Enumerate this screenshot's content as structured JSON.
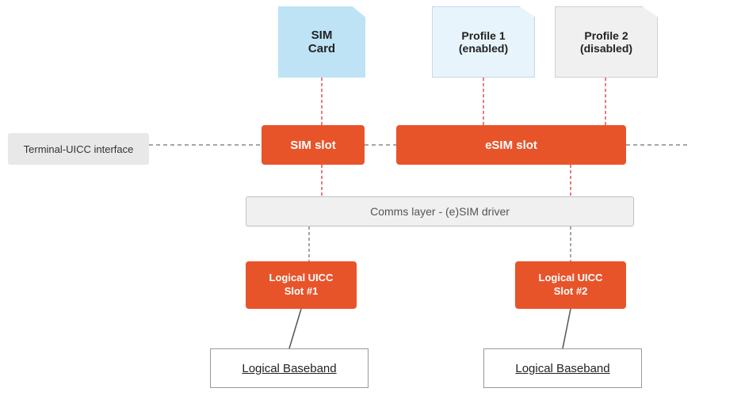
{
  "cards": {
    "sim_card": {
      "label": "SIM\nCard"
    },
    "profile1": {
      "label": "Profile 1\n(enabled)"
    },
    "profile2": {
      "label": "Profile 2\n(disabled)"
    }
  },
  "interface": {
    "terminal_uicc": "Terminal-UICC interface"
  },
  "slots": {
    "sim_slot": "SIM slot",
    "esim_slot": "eSIM slot"
  },
  "comms_layer": "Comms layer - (e)SIM driver",
  "logical_uicc": {
    "slot1": "Logical UICC\nSlot #1",
    "slot2": "Logical UICC\nSlot #2"
  },
  "baseband": {
    "bb1": "Logical  Baseband",
    "bb2": "Logical Baseband"
  }
}
